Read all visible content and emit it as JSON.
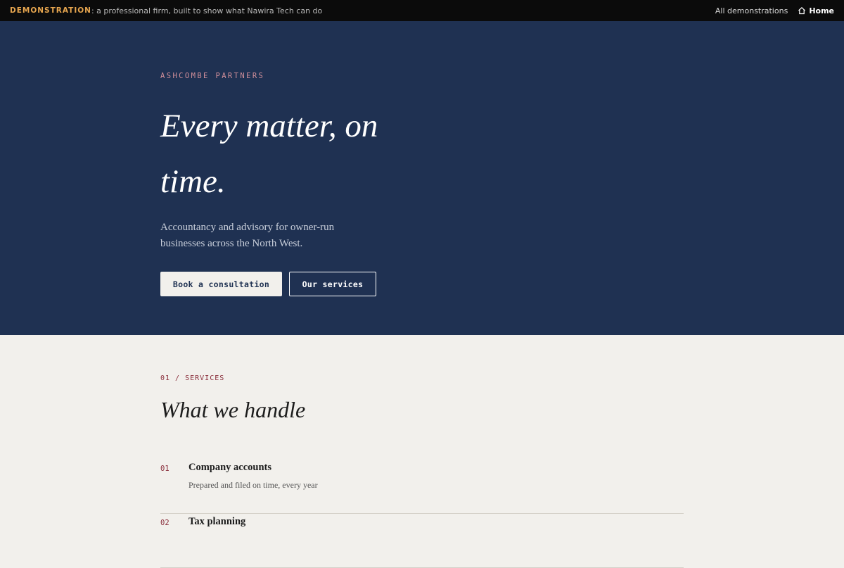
{
  "demo_bar": {
    "tag": "DEMONSTRATION",
    "message": ": a professional firm, built to show what Nawira Tech can do",
    "all_demos": "All demonstrations",
    "home": "Home"
  },
  "hero": {
    "eyebrow": "ASHCOMBE PARTNERS",
    "title": "Every matter, on time.",
    "subtitle": "Accountancy and advisory for owner-run businesses across the North West.",
    "primary_button": "Book a consultation",
    "secondary_button": "Our services"
  },
  "services": {
    "label": "01 / SERVICES",
    "title": "What we handle",
    "items": [
      {
        "num": "01",
        "name": "Company accounts",
        "desc": "Prepared and filed on time, every year"
      },
      {
        "num": "02",
        "name": "Tax planning",
        "desc": ""
      }
    ]
  },
  "colors": {
    "hero_bg": "#1f3152",
    "page_bg": "#f2f0ec",
    "accent": "#8a2f3c",
    "demo_tag": "#e7a64f"
  }
}
